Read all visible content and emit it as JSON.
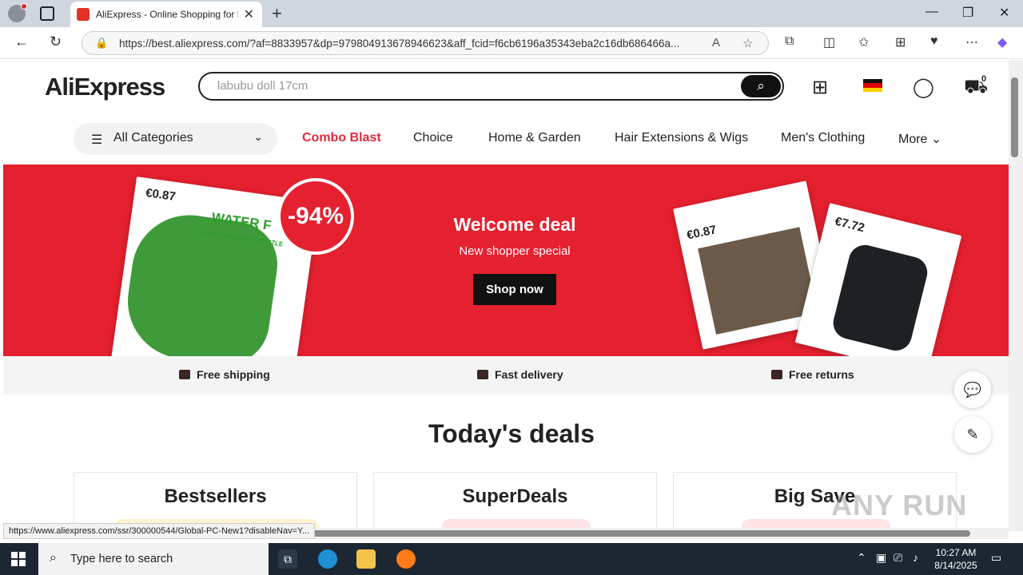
{
  "browser": {
    "tab_title": "AliExpress - Online Shopping for Popular Electronics, Fashion, Home & Garden, Toys & Sports, Automobiles and More.",
    "url": "https://best.aliexpress.com/?af=8833957&dp=979804913678946623&aff_fcid=f6cb6196a35343eba2c16db686466a...",
    "status_url": "https://www.aliexpress.com/ssr/300000544/Global-PC-New1?disableNav=Y...",
    "icons": [
      "profile-icon",
      "tab-actions-icon",
      "back-icon",
      "refresh-icon",
      "lock-icon",
      "read-aloud-icon",
      "favorite-star-icon",
      "extensions-icon",
      "split-screen-icon",
      "favorites-icon",
      "collections-icon",
      "performance-icon",
      "menu-icon",
      "copilot-icon"
    ]
  },
  "header": {
    "logo_text": "AliExpress",
    "search_placeholder": "labubu doll 17cm",
    "cart_count": "0"
  },
  "nav": {
    "all_categories": "All Categories",
    "links": [
      "Combo Blast",
      "Choice",
      "Home & Garden",
      "Hair Extensions & Wigs",
      "Men's Clothing",
      "More"
    ]
  },
  "banner": {
    "left_price": "€0.87",
    "discount": "-94%",
    "title": "Welcome deal",
    "subtitle": "New shopper special",
    "cta": "Shop now",
    "right_price_1": "€0.87",
    "right_price_2": "€7.72",
    "product_text": "WATER F",
    "product_sub": "7 FUNCTION SPRAY NOZZLE"
  },
  "perks": [
    "Free shipping",
    "Fast delivery",
    "Free returns"
  ],
  "deals": {
    "title": "Today's deals",
    "cards": [
      "Bestsellers",
      "SuperDeals",
      "Big Save"
    ]
  },
  "taskbar": {
    "search_text": "Type here to search",
    "time": "10:27 AM",
    "date": "8/14/2025"
  },
  "watermark": "ANY RUN",
  "colors": {
    "brand_red": "#e5202f",
    "hot_link": "#e02b3c",
    "black": "#111111"
  }
}
